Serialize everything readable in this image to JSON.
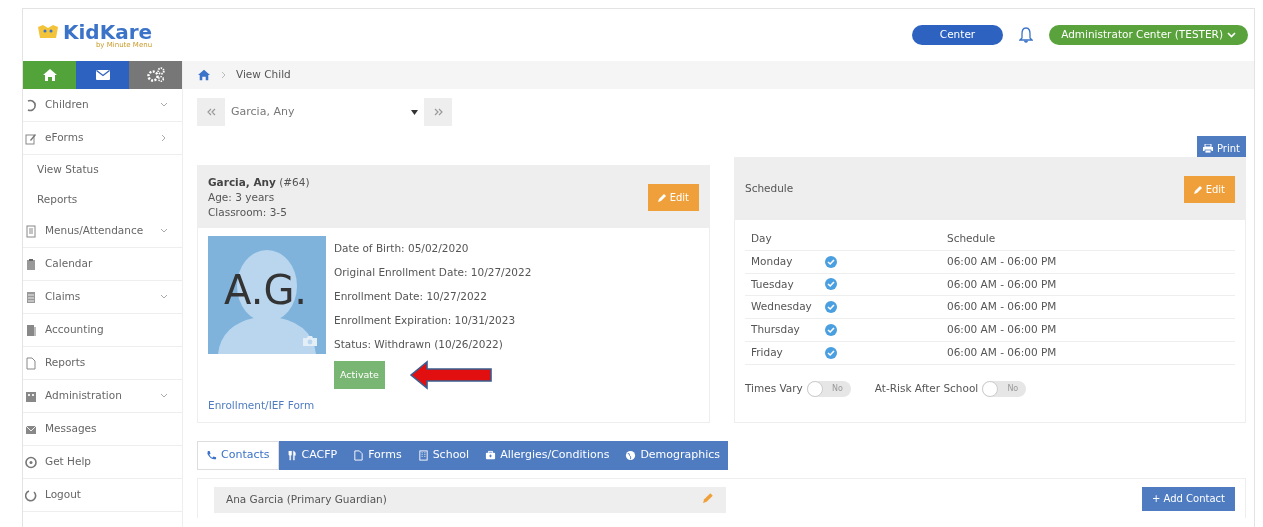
{
  "header": {
    "logo": "KidKare",
    "logo_sub": "by Minute Menu",
    "center_button": "Center",
    "user_menu": "Administrator Center (TESTER)"
  },
  "sidebar": {
    "items": [
      {
        "label": "Children",
        "kind": "dropdown"
      },
      {
        "label": "eForms",
        "kind": "flyout"
      },
      {
        "label": "View Status",
        "kind": "sub"
      },
      {
        "label": "Reports",
        "kind": "sub"
      },
      {
        "label": "Menus/Attendance",
        "kind": "dropdown"
      },
      {
        "label": "Calendar",
        "kind": "main"
      },
      {
        "label": "Claims",
        "kind": "dropdown"
      },
      {
        "label": "Accounting",
        "kind": "main"
      },
      {
        "label": "Reports",
        "kind": "main"
      },
      {
        "label": "Administration",
        "kind": "dropdown"
      },
      {
        "label": "Messages",
        "kind": "main"
      },
      {
        "label": "Get Help",
        "kind": "main"
      },
      {
        "label": "Logout",
        "kind": "main"
      }
    ]
  },
  "breadcrumb": "View Child",
  "child_picker": {
    "value": "Garcia, Any"
  },
  "print_button": "Print",
  "child_card": {
    "name": "Garcia, Any",
    "number": "(#64)",
    "age": "Age: 3 years",
    "classroom": "Classroom: 3-5",
    "edit_button": "Edit",
    "initials": "A.G.",
    "details": [
      "Date of Birth: 05/02/2020",
      "Original Enrollment Date: 10/27/2022",
      "Enrollment Date: 10/27/2022",
      "Enrollment Expiration: 10/31/2023",
      "Status: Withdrawn (10/26/2022)"
    ],
    "activate_button": "Activate",
    "form_link": "Enrollment/IEF Form"
  },
  "schedule_card": {
    "title": "Schedule",
    "edit_button": "Edit",
    "columns": [
      "Day",
      "Schedule"
    ],
    "rows": [
      {
        "day": "Monday",
        "checked": true,
        "time": "06:00 AM - 06:00 PM"
      },
      {
        "day": "Tuesday",
        "checked": true,
        "time": "06:00 AM - 06:00 PM"
      },
      {
        "day": "Wednesday",
        "checked": true,
        "time": "06:00 AM - 06:00 PM"
      },
      {
        "day": "Thursday",
        "checked": true,
        "time": "06:00 AM - 06:00 PM"
      },
      {
        "day": "Friday",
        "checked": true,
        "time": "06:00 AM - 06:00 PM"
      }
    ],
    "toggles": [
      {
        "label": "Times Vary",
        "on": false,
        "text": "No"
      },
      {
        "label": "At-Risk After School",
        "on": false,
        "text": "No"
      }
    ]
  },
  "tabs": [
    {
      "label": "Contacts",
      "selected": true
    },
    {
      "label": "CACFP",
      "selected": false
    },
    {
      "label": "Forms",
      "selected": false
    },
    {
      "label": "School",
      "selected": false
    },
    {
      "label": "Allergies/Conditions",
      "selected": false
    },
    {
      "label": "Demographics",
      "selected": false
    }
  ],
  "contacts": {
    "first_contact": "Ana Garcia (Primary Guardian)",
    "add_button": "+ Add Contact"
  }
}
